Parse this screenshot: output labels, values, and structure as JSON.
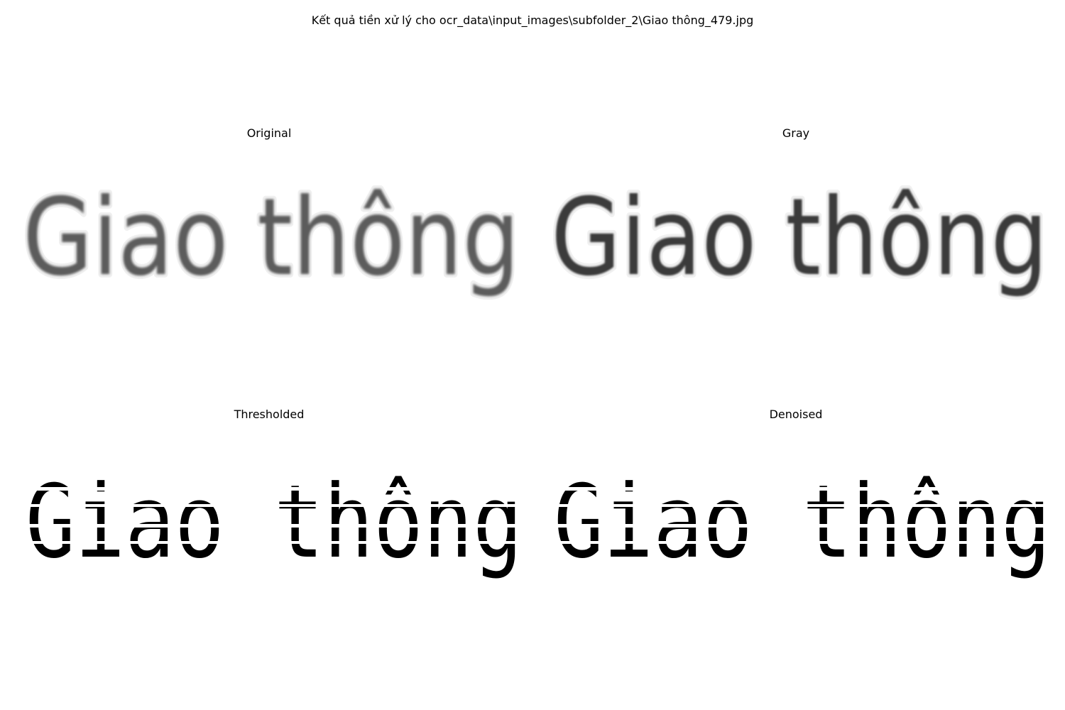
{
  "figure_title": "Kết quả tiền xử lý cho ocr_data\\input_images\\subfolder_2\\Giao thông_479.jpg",
  "panels": [
    {
      "title": "Original",
      "word": "Giao thông"
    },
    {
      "title": "Gray",
      "word": "Giao thông"
    },
    {
      "title": "Thresholded",
      "word": "Giao thông"
    },
    {
      "title": "Denoised",
      "word": "Giao thông"
    }
  ]
}
